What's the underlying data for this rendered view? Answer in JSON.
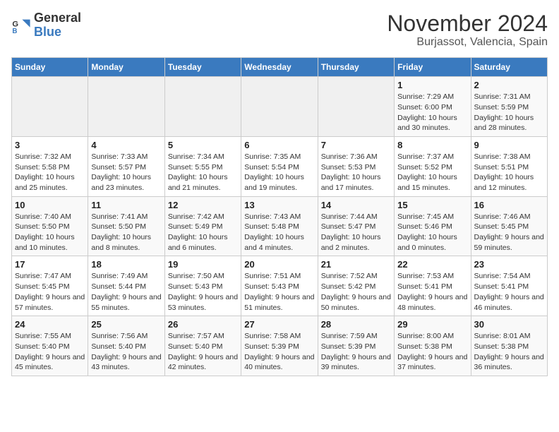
{
  "header": {
    "logo_general": "General",
    "logo_blue": "Blue",
    "title": "November 2024",
    "subtitle": "Burjassot, Valencia, Spain"
  },
  "days_of_week": [
    "Sunday",
    "Monday",
    "Tuesday",
    "Wednesday",
    "Thursday",
    "Friday",
    "Saturday"
  ],
  "weeks": [
    [
      {
        "day": "",
        "info": ""
      },
      {
        "day": "",
        "info": ""
      },
      {
        "day": "",
        "info": ""
      },
      {
        "day": "",
        "info": ""
      },
      {
        "day": "",
        "info": ""
      },
      {
        "day": "1",
        "info": "Sunrise: 7:29 AM\nSunset: 6:00 PM\nDaylight: 10 hours and 30 minutes."
      },
      {
        "day": "2",
        "info": "Sunrise: 7:31 AM\nSunset: 5:59 PM\nDaylight: 10 hours and 28 minutes."
      }
    ],
    [
      {
        "day": "3",
        "info": "Sunrise: 7:32 AM\nSunset: 5:58 PM\nDaylight: 10 hours and 25 minutes."
      },
      {
        "day": "4",
        "info": "Sunrise: 7:33 AM\nSunset: 5:57 PM\nDaylight: 10 hours and 23 minutes."
      },
      {
        "day": "5",
        "info": "Sunrise: 7:34 AM\nSunset: 5:55 PM\nDaylight: 10 hours and 21 minutes."
      },
      {
        "day": "6",
        "info": "Sunrise: 7:35 AM\nSunset: 5:54 PM\nDaylight: 10 hours and 19 minutes."
      },
      {
        "day": "7",
        "info": "Sunrise: 7:36 AM\nSunset: 5:53 PM\nDaylight: 10 hours and 17 minutes."
      },
      {
        "day": "8",
        "info": "Sunrise: 7:37 AM\nSunset: 5:52 PM\nDaylight: 10 hours and 15 minutes."
      },
      {
        "day": "9",
        "info": "Sunrise: 7:38 AM\nSunset: 5:51 PM\nDaylight: 10 hours and 12 minutes."
      }
    ],
    [
      {
        "day": "10",
        "info": "Sunrise: 7:40 AM\nSunset: 5:50 PM\nDaylight: 10 hours and 10 minutes."
      },
      {
        "day": "11",
        "info": "Sunrise: 7:41 AM\nSunset: 5:50 PM\nDaylight: 10 hours and 8 minutes."
      },
      {
        "day": "12",
        "info": "Sunrise: 7:42 AM\nSunset: 5:49 PM\nDaylight: 10 hours and 6 minutes."
      },
      {
        "day": "13",
        "info": "Sunrise: 7:43 AM\nSunset: 5:48 PM\nDaylight: 10 hours and 4 minutes."
      },
      {
        "day": "14",
        "info": "Sunrise: 7:44 AM\nSunset: 5:47 PM\nDaylight: 10 hours and 2 minutes."
      },
      {
        "day": "15",
        "info": "Sunrise: 7:45 AM\nSunset: 5:46 PM\nDaylight: 10 hours and 0 minutes."
      },
      {
        "day": "16",
        "info": "Sunrise: 7:46 AM\nSunset: 5:45 PM\nDaylight: 9 hours and 59 minutes."
      }
    ],
    [
      {
        "day": "17",
        "info": "Sunrise: 7:47 AM\nSunset: 5:45 PM\nDaylight: 9 hours and 57 minutes."
      },
      {
        "day": "18",
        "info": "Sunrise: 7:49 AM\nSunset: 5:44 PM\nDaylight: 9 hours and 55 minutes."
      },
      {
        "day": "19",
        "info": "Sunrise: 7:50 AM\nSunset: 5:43 PM\nDaylight: 9 hours and 53 minutes."
      },
      {
        "day": "20",
        "info": "Sunrise: 7:51 AM\nSunset: 5:43 PM\nDaylight: 9 hours and 51 minutes."
      },
      {
        "day": "21",
        "info": "Sunrise: 7:52 AM\nSunset: 5:42 PM\nDaylight: 9 hours and 50 minutes."
      },
      {
        "day": "22",
        "info": "Sunrise: 7:53 AM\nSunset: 5:41 PM\nDaylight: 9 hours and 48 minutes."
      },
      {
        "day": "23",
        "info": "Sunrise: 7:54 AM\nSunset: 5:41 PM\nDaylight: 9 hours and 46 minutes."
      }
    ],
    [
      {
        "day": "24",
        "info": "Sunrise: 7:55 AM\nSunset: 5:40 PM\nDaylight: 9 hours and 45 minutes."
      },
      {
        "day": "25",
        "info": "Sunrise: 7:56 AM\nSunset: 5:40 PM\nDaylight: 9 hours and 43 minutes."
      },
      {
        "day": "26",
        "info": "Sunrise: 7:57 AM\nSunset: 5:40 PM\nDaylight: 9 hours and 42 minutes."
      },
      {
        "day": "27",
        "info": "Sunrise: 7:58 AM\nSunset: 5:39 PM\nDaylight: 9 hours and 40 minutes."
      },
      {
        "day": "28",
        "info": "Sunrise: 7:59 AM\nSunset: 5:39 PM\nDaylight: 9 hours and 39 minutes."
      },
      {
        "day": "29",
        "info": "Sunrise: 8:00 AM\nSunset: 5:38 PM\nDaylight: 9 hours and 37 minutes."
      },
      {
        "day": "30",
        "info": "Sunrise: 8:01 AM\nSunset: 5:38 PM\nDaylight: 9 hours and 36 minutes."
      }
    ]
  ]
}
